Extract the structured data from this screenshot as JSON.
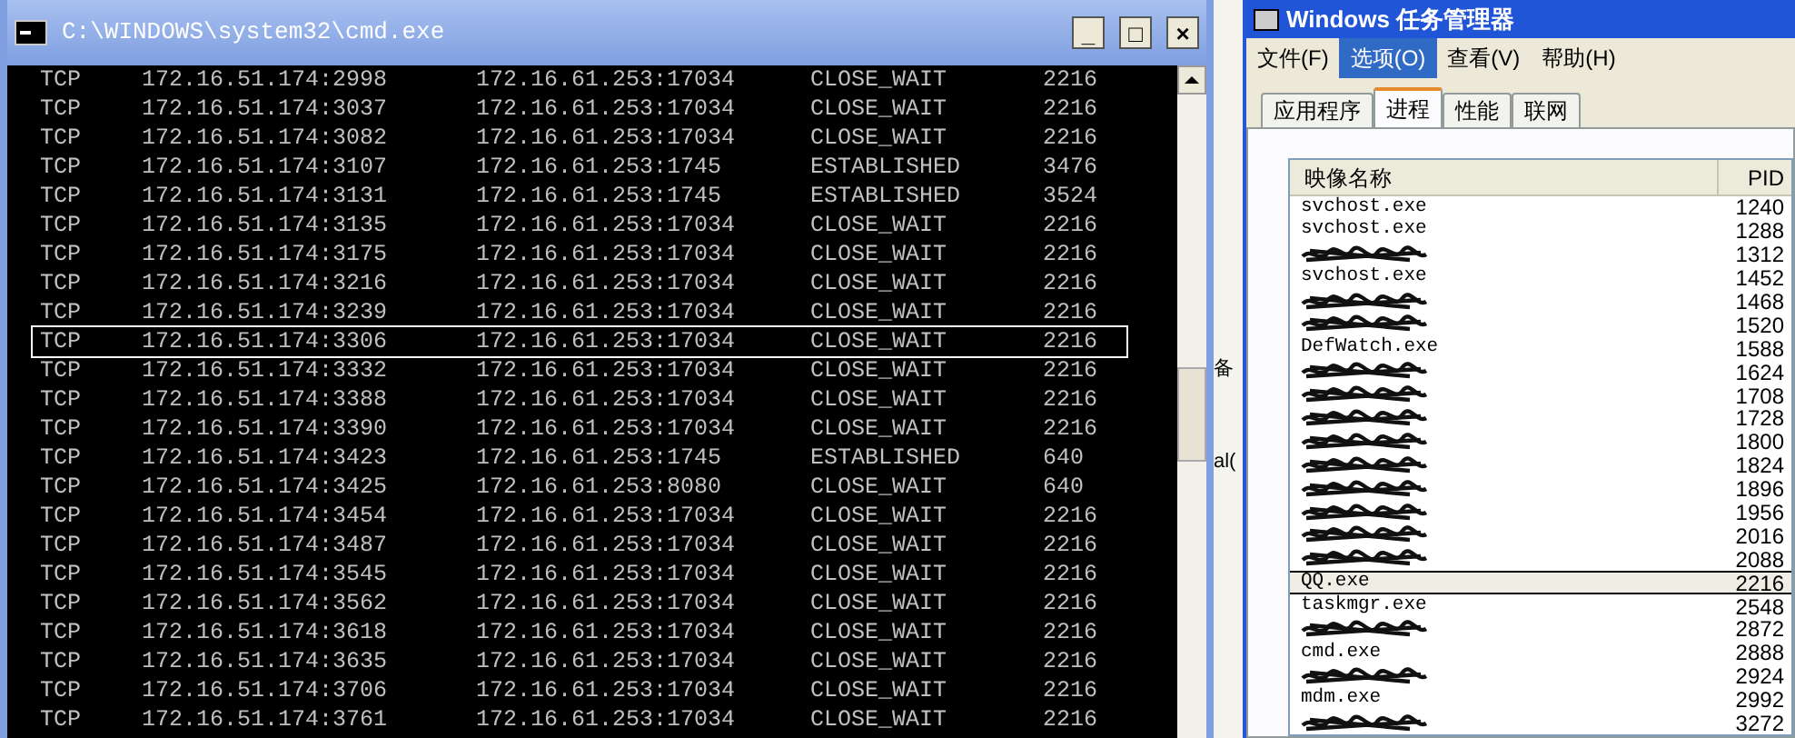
{
  "cmd_window": {
    "title": "C:\\WINDOWS\\system32\\cmd.exe",
    "window_buttons": [
      "_",
      "□",
      "×"
    ],
    "rows": [
      {
        "proto": "TCP",
        "local": "172.16.51.174:2998",
        "foreign": "172.16.61.253:17034",
        "state": "CLOSE_WAIT",
        "pid": "2216",
        "selected": false
      },
      {
        "proto": "TCP",
        "local": "172.16.51.174:3037",
        "foreign": "172.16.61.253:17034",
        "state": "CLOSE_WAIT",
        "pid": "2216",
        "selected": false
      },
      {
        "proto": "TCP",
        "local": "172.16.51.174:3082",
        "foreign": "172.16.61.253:17034",
        "state": "CLOSE_WAIT",
        "pid": "2216",
        "selected": false
      },
      {
        "proto": "TCP",
        "local": "172.16.51.174:3107",
        "foreign": "172.16.61.253:1745",
        "state": "ESTABLISHED",
        "pid": "3476",
        "selected": false
      },
      {
        "proto": "TCP",
        "local": "172.16.51.174:3131",
        "foreign": "172.16.61.253:1745",
        "state": "ESTABLISHED",
        "pid": "3524",
        "selected": false
      },
      {
        "proto": "TCP",
        "local": "172.16.51.174:3135",
        "foreign": "172.16.61.253:17034",
        "state": "CLOSE_WAIT",
        "pid": "2216",
        "selected": false
      },
      {
        "proto": "TCP",
        "local": "172.16.51.174:3175",
        "foreign": "172.16.61.253:17034",
        "state": "CLOSE_WAIT",
        "pid": "2216",
        "selected": false
      },
      {
        "proto": "TCP",
        "local": "172.16.51.174:3216",
        "foreign": "172.16.61.253:17034",
        "state": "CLOSE_WAIT",
        "pid": "2216",
        "selected": false
      },
      {
        "proto": "TCP",
        "local": "172.16.51.174:3239",
        "foreign": "172.16.61.253:17034",
        "state": "CLOSE_WAIT",
        "pid": "2216",
        "selected": false
      },
      {
        "proto": "TCP",
        "local": "172.16.51.174:3306",
        "foreign": "172.16.61.253:17034",
        "state": "CLOSE_WAIT",
        "pid": "2216",
        "selected": true
      },
      {
        "proto": "TCP",
        "local": "172.16.51.174:3332",
        "foreign": "172.16.61.253:17034",
        "state": "CLOSE_WAIT",
        "pid": "2216",
        "selected": false
      },
      {
        "proto": "TCP",
        "local": "172.16.51.174:3388",
        "foreign": "172.16.61.253:17034",
        "state": "CLOSE_WAIT",
        "pid": "2216",
        "selected": false
      },
      {
        "proto": "TCP",
        "local": "172.16.51.174:3390",
        "foreign": "172.16.61.253:17034",
        "state": "CLOSE_WAIT",
        "pid": "2216",
        "selected": false
      },
      {
        "proto": "TCP",
        "local": "172.16.51.174:3423",
        "foreign": "172.16.61.253:1745",
        "state": "ESTABLISHED",
        "pid": "640",
        "selected": false
      },
      {
        "proto": "TCP",
        "local": "172.16.51.174:3425",
        "foreign": "172.16.61.253:8080",
        "state": "CLOSE_WAIT",
        "pid": "640",
        "selected": false
      },
      {
        "proto": "TCP",
        "local": "172.16.51.174:3454",
        "foreign": "172.16.61.253:17034",
        "state": "CLOSE_WAIT",
        "pid": "2216",
        "selected": false
      },
      {
        "proto": "TCP",
        "local": "172.16.51.174:3487",
        "foreign": "172.16.61.253:17034",
        "state": "CLOSE_WAIT",
        "pid": "2216",
        "selected": false
      },
      {
        "proto": "TCP",
        "local": "172.16.51.174:3545",
        "foreign": "172.16.61.253:17034",
        "state": "CLOSE_WAIT",
        "pid": "2216",
        "selected": false
      },
      {
        "proto": "TCP",
        "local": "172.16.51.174:3562",
        "foreign": "172.16.61.253:17034",
        "state": "CLOSE_WAIT",
        "pid": "2216",
        "selected": false
      },
      {
        "proto": "TCP",
        "local": "172.16.51.174:3618",
        "foreign": "172.16.61.253:17034",
        "state": "CLOSE_WAIT",
        "pid": "2216",
        "selected": false
      },
      {
        "proto": "TCP",
        "local": "172.16.51.174:3635",
        "foreign": "172.16.61.253:17034",
        "state": "CLOSE_WAIT",
        "pid": "2216",
        "selected": false
      },
      {
        "proto": "TCP",
        "local": "172.16.51.174:3706",
        "foreign": "172.16.61.253:17034",
        "state": "CLOSE_WAIT",
        "pid": "2216",
        "selected": false
      },
      {
        "proto": "TCP",
        "local": "172.16.51.174:3761",
        "foreign": "172.16.61.253:17034",
        "state": "CLOSE_WAIT",
        "pid": "2216",
        "selected": false
      }
    ]
  },
  "background_window": {
    "texts": [
      "备",
      "al("
    ]
  },
  "task_manager": {
    "title": "Windows 任务管理器",
    "menu": [
      {
        "label": "文件(F)",
        "selected": false
      },
      {
        "label": "选项(O)",
        "selected": true
      },
      {
        "label": "查看(V)",
        "selected": false
      },
      {
        "label": "帮助(H)",
        "selected": false
      }
    ],
    "tabs": [
      {
        "label": "应用程序",
        "selected": false
      },
      {
        "label": "进程",
        "selected": true
      },
      {
        "label": "性能",
        "selected": false
      },
      {
        "label": "联网",
        "selected": false
      }
    ],
    "columns": [
      "映像名称",
      "PID"
    ],
    "rows": [
      {
        "name": "svchost.exe",
        "redacted": false,
        "pid": "1240",
        "selected": false
      },
      {
        "name": "svchost.exe",
        "redacted": false,
        "pid": "1288",
        "selected": false
      },
      {
        "redacted": true,
        "pid": "1312",
        "selected": false
      },
      {
        "name": "svchost.exe",
        "redacted": false,
        "pid": "1452",
        "selected": false
      },
      {
        "redacted": true,
        "pid": "1468",
        "selected": false
      },
      {
        "redacted": true,
        "pid": "1520",
        "selected": false
      },
      {
        "name": "DefWatch.exe",
        "redacted": false,
        "pid": "1588",
        "selected": false
      },
      {
        "redacted": true,
        "pid": "1624",
        "selected": false
      },
      {
        "redacted": true,
        "pid": "1708",
        "selected": false
      },
      {
        "redacted": true,
        "pid": "1728",
        "selected": false
      },
      {
        "redacted": true,
        "pid": "1800",
        "selected": false
      },
      {
        "redacted": true,
        "pid": "1824",
        "selected": false
      },
      {
        "redacted": true,
        "pid": "1896",
        "selected": false
      },
      {
        "redacted": true,
        "pid": "1956",
        "selected": false
      },
      {
        "redacted": true,
        "pid": "2016",
        "selected": false
      },
      {
        "redacted": true,
        "pid": "2088",
        "selected": false
      },
      {
        "name": "QQ.exe",
        "redacted": false,
        "pid": "2216",
        "selected": true
      },
      {
        "name": "taskmgr.exe",
        "redacted": false,
        "pid": "2548",
        "selected": false
      },
      {
        "redacted": true,
        "pid": "2872",
        "selected": false
      },
      {
        "name": "cmd.exe",
        "redacted": false,
        "pid": "2888",
        "selected": false
      },
      {
        "redacted": true,
        "pid": "2924",
        "selected": false
      },
      {
        "name": "mdm.exe",
        "redacted": false,
        "pid": "2992",
        "selected": false
      },
      {
        "redacted": true,
        "pid": "3272",
        "selected": false
      }
    ]
  }
}
